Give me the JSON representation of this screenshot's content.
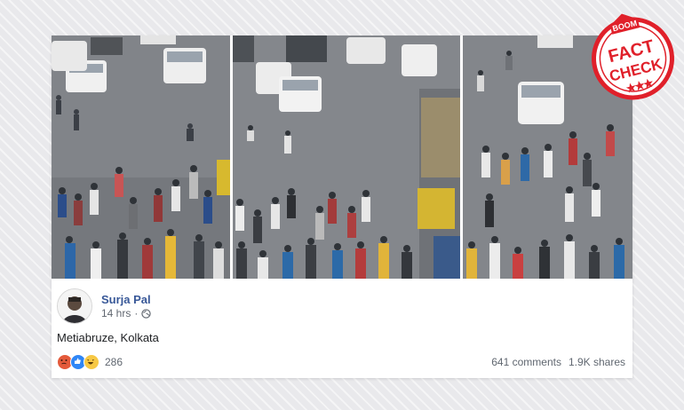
{
  "post": {
    "author_name": "Surja Pal",
    "timestamp": "14 hrs",
    "separator": "·",
    "text": "Metiabruze, Kolkata",
    "reaction_count": "286",
    "comments": "641 comments",
    "shares": "1.9K shares"
  },
  "stamp": {
    "top_word": "BOOM",
    "word_1": "FACT",
    "word_2": "CHECK",
    "color": "#e0202a"
  },
  "colors": {
    "author_link": "#385898",
    "meta_text": "#606770"
  },
  "icons": {
    "privacy": "globe-icon",
    "reactions": [
      "angry-reaction-icon",
      "like-reaction-icon",
      "haha-reaction-icon"
    ]
  }
}
